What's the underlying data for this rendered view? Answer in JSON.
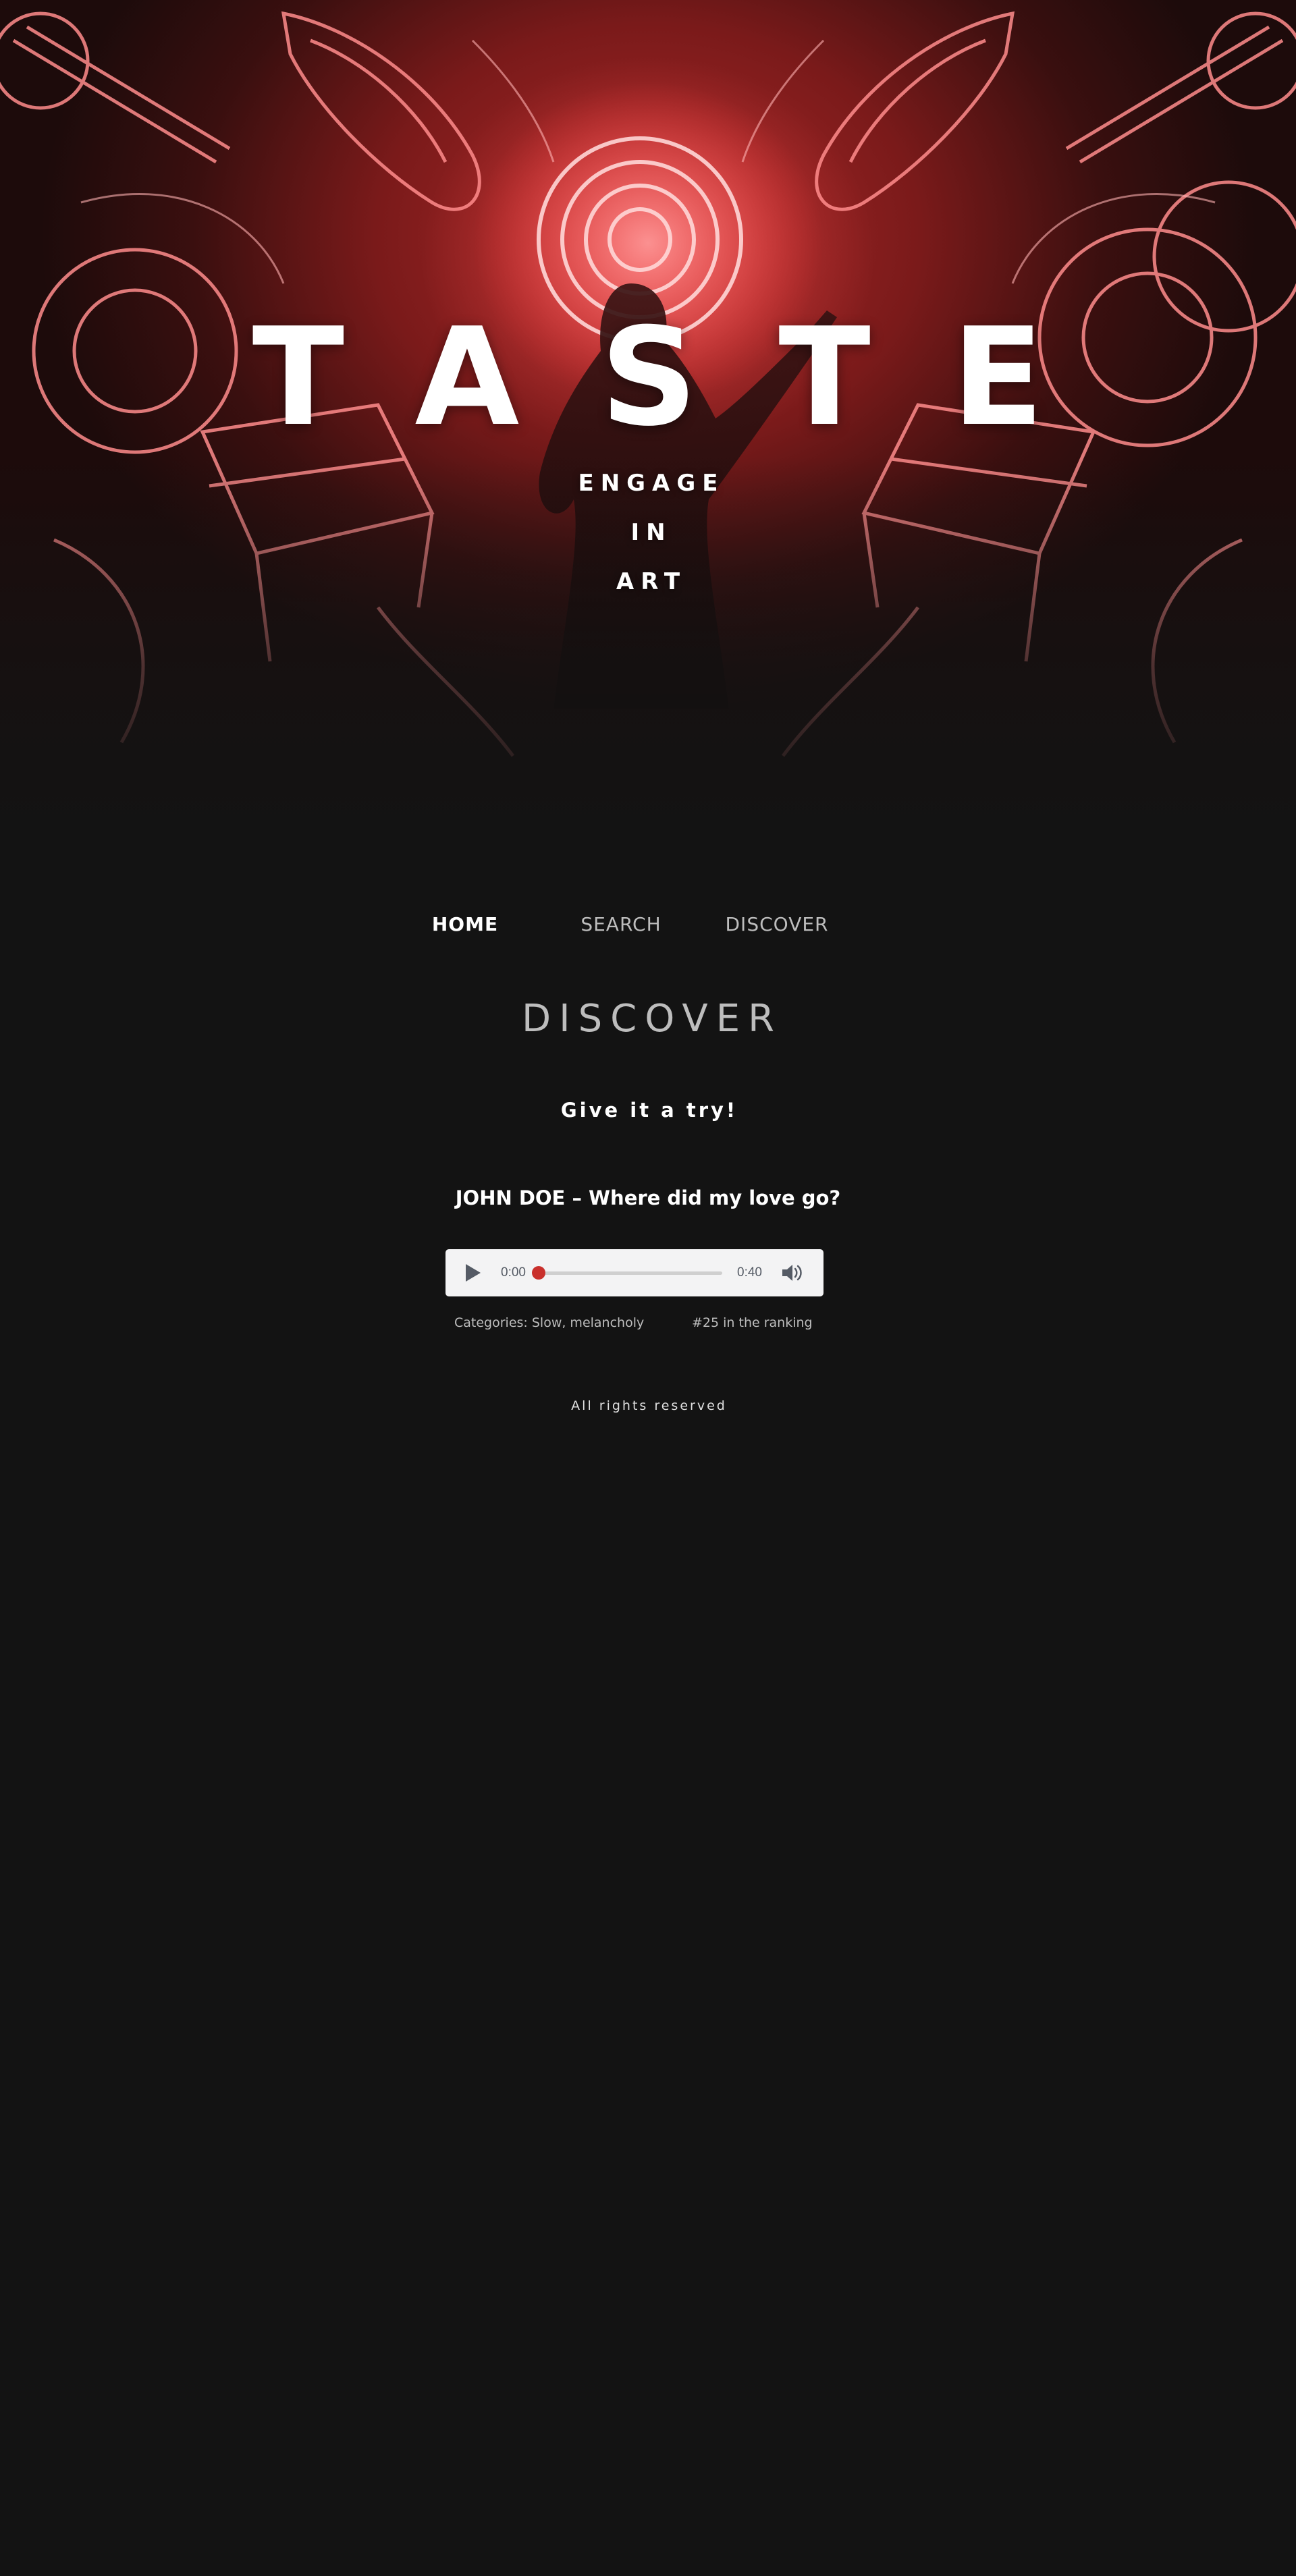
{
  "hero": {
    "title": "TASTE",
    "tagline": [
      "ENGAGE",
      "IN",
      "ART"
    ]
  },
  "nav": {
    "items": [
      {
        "label": "HOME",
        "active": true
      },
      {
        "label": "SEARCH",
        "active": false
      },
      {
        "label": "DISCOVER",
        "active": false
      }
    ]
  },
  "main": {
    "heading": "DISCOVER",
    "subtitle": "Give it a try!",
    "track": {
      "title": "JOHN DOE – Where did my love go?",
      "current_time": "0:00",
      "duration": "0:40",
      "progress": 0,
      "categories": "Categories: Slow, melancholy",
      "ranking": "#25 in the ranking"
    }
  },
  "footer": {
    "text": "All rights reserved"
  },
  "colors": {
    "background": "#131313",
    "accent": "#c9302c",
    "nav_inactive": "#bdbdbd",
    "player_bg": "#f3f3f4"
  },
  "icons": {
    "play": "play-icon",
    "volume": "volume-icon"
  }
}
